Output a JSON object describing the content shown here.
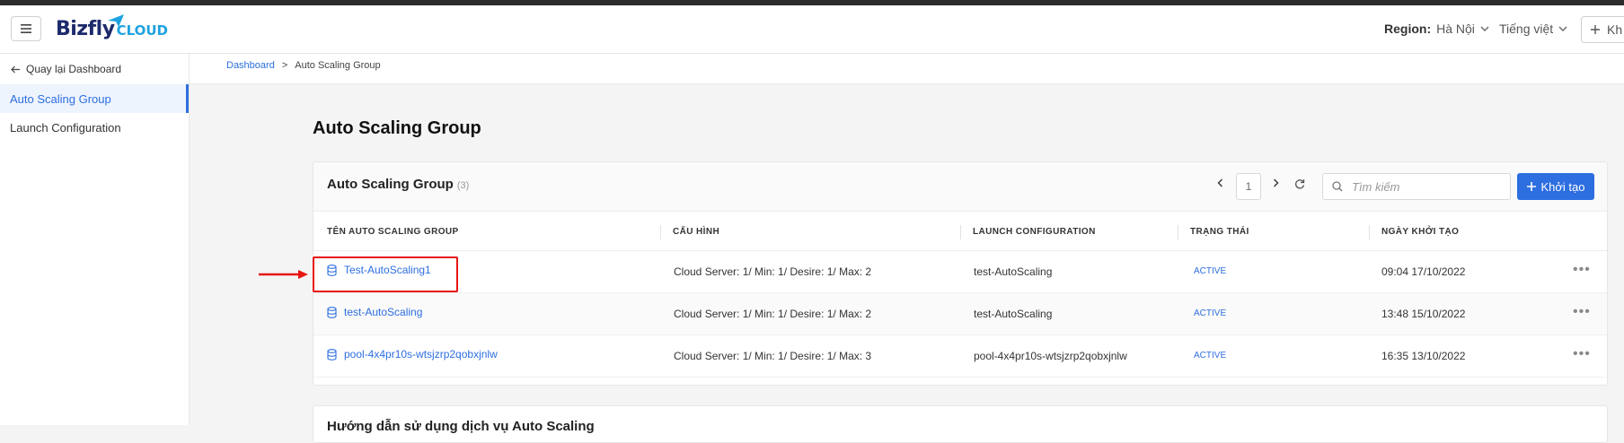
{
  "header": {
    "logo_biz": "Bizfly",
    "logo_cloud": "CLOUD",
    "region_label": "Region:",
    "region_value": "Hà Nội",
    "language": "Tiếng việt",
    "right_button": "Kh"
  },
  "sidebar": {
    "back_label": "Quay lại Dashboard",
    "items": [
      {
        "label": "Auto Scaling Group",
        "active": true
      },
      {
        "label": "Launch Configuration",
        "active": false
      }
    ]
  },
  "breadcrumb": {
    "home": "Dashboard",
    "separator": ">",
    "current": "Auto Scaling Group"
  },
  "page": {
    "title": "Auto Scaling Group"
  },
  "card": {
    "title": "Auto Scaling Group",
    "count": "(3)",
    "page_number": "1",
    "search_placeholder": "Tìm kiếm",
    "create_label": "Khởi tạo",
    "columns": {
      "name": "TÊN AUTO SCALING GROUP",
      "config": "CẤU HÌNH",
      "launch": "LAUNCH CONFIGURATION",
      "status": "TRẠNG THÁI",
      "created": "NGÀY KHỞI TẠO"
    },
    "rows": [
      {
        "name": "Test-AutoScaling1",
        "config": "Cloud Server: 1/ Min: 1/ Desire: 1/ Max: 2",
        "launch": "test-AutoScaling",
        "status": "ACTIVE",
        "created": "09:04 17/10/2022"
      },
      {
        "name": "test-AutoScaling",
        "config": "Cloud Server: 1/ Min: 1/ Desire: 1/ Max: 2",
        "launch": "test-AutoScaling",
        "status": "ACTIVE",
        "created": "13:48 15/10/2022"
      },
      {
        "name": "pool-4x4pr10s-wtsjzrp2qobxjnlw",
        "config": "Cloud Server: 1/ Min: 1/ Desire: 1/ Max: 3",
        "launch": "pool-4x4pr10s-wtsjzrp2qobxjnlw",
        "status": "ACTIVE",
        "created": "16:35 13/10/2022"
      }
    ],
    "more_label": "•••"
  },
  "second_card": {
    "title": "Hướng dẫn sử dụng dịch vụ Auto Scaling"
  },
  "colors": {
    "accent": "#2d6ee0",
    "annotation": "#e81414"
  }
}
